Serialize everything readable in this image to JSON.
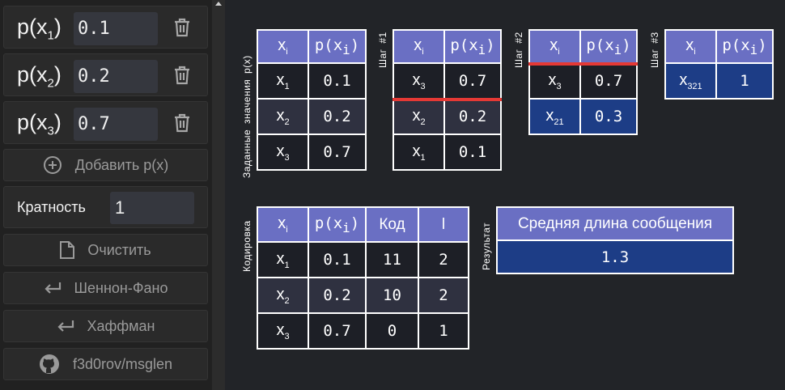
{
  "sidebar": {
    "probabilities": [
      {
        "label": "p(x",
        "index": "1",
        "value": "0.1"
      },
      {
        "label": "p(x",
        "index": "2",
        "value": "0.2"
      },
      {
        "label": "p(x",
        "index": "3",
        "value": "0.7"
      }
    ],
    "add_label": "Добавить p(x)",
    "multiplicity_label": "Кратность",
    "multiplicity_value": "1",
    "clear_label": "Очистить",
    "shannon_label": "Шеннон-Фано",
    "huffman_label": "Хаффман",
    "github_label": "f3d0rov/msglen"
  },
  "headers": {
    "xi": "x",
    "xi_sub": "i",
    "pxi": "p(x",
    "pxi_sub": "i",
    "pxi_close": ")",
    "code": "Код",
    "l": "l"
  },
  "given": {
    "label": "Заданные значения p(x)",
    "rows": [
      {
        "x": "x",
        "sub": "1",
        "p": "0.1"
      },
      {
        "x": "x",
        "sub": "2",
        "p": "0.2"
      },
      {
        "x": "x",
        "sub": "3",
        "p": "0.7"
      }
    ]
  },
  "step1": {
    "label": "Шаг #1",
    "rows": [
      {
        "x": "x",
        "sub": "3",
        "p": "0.7"
      },
      {
        "x": "x",
        "sub": "2",
        "p": "0.2"
      },
      {
        "x": "x",
        "sub": "1",
        "p": "0.1"
      }
    ]
  },
  "step2": {
    "label": "Шаг #2",
    "rows": [
      {
        "x": "x",
        "sub": "3",
        "p": "0.7"
      },
      {
        "x": "x",
        "sub": "21",
        "p": "0.3"
      }
    ]
  },
  "step3": {
    "label": "Шаг #3",
    "rows": [
      {
        "x": "x",
        "sub": "321",
        "p": "1"
      }
    ]
  },
  "coding": {
    "label": "Кодировка",
    "rows": [
      {
        "x": "x",
        "sub": "1",
        "p": "0.1",
        "code": "11",
        "l": "2"
      },
      {
        "x": "x",
        "sub": "2",
        "p": "0.2",
        "code": "10",
        "l": "2"
      },
      {
        "x": "x",
        "sub": "3",
        "p": "0.7",
        "code": "0",
        "l": "1"
      }
    ]
  },
  "result": {
    "label": "Результат",
    "header": "Средняя длина сообщения",
    "value": "1.3"
  },
  "colors": {
    "header_bg": "#6a6fc3",
    "highlight_bg": "#1d3d86",
    "divider": "#e53935"
  }
}
